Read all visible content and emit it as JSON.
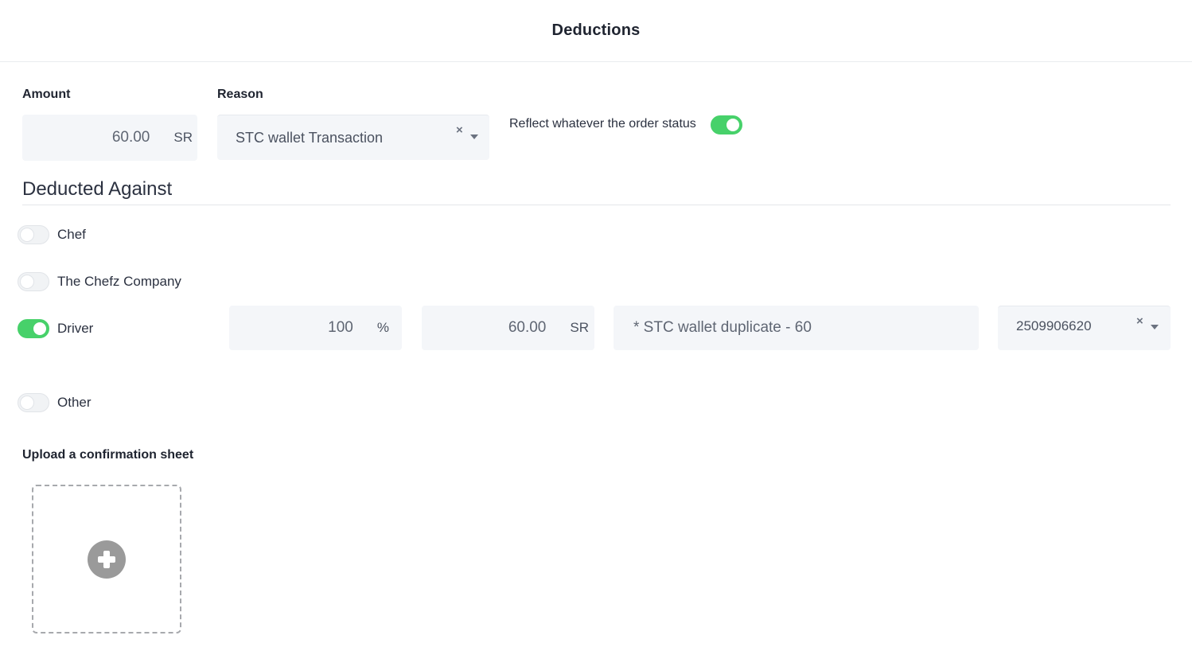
{
  "header": {
    "title": "Deductions"
  },
  "form": {
    "amount_label": "Amount",
    "amount_value": "60.00",
    "amount_unit": "SR",
    "reason_label": "Reason",
    "reason_value": "STC wallet Transaction",
    "clear_glyph": "×",
    "reflect_label": "Reflect whatever the order status",
    "reflect_on": true
  },
  "deducted_against": {
    "title": "Deducted Against",
    "options": [
      {
        "label": "Chef",
        "on": false
      },
      {
        "label": "The Chefz Company",
        "on": false
      },
      {
        "label": "Driver",
        "on": true
      },
      {
        "label": "Other",
        "on": false
      }
    ],
    "driver": {
      "percent_value": "100",
      "percent_unit": "%",
      "amount_value": "60.00",
      "amount_unit": "SR",
      "note": "* STC wallet duplicate - 60",
      "driver_id": "2509906620",
      "clear_glyph": "×"
    }
  },
  "upload": {
    "label": "Upload a confirmation sheet",
    "icon": "plus-circle-icon"
  },
  "colors": {
    "toggle_on": "#47d16a",
    "input_bg": "#f4f6f9"
  }
}
